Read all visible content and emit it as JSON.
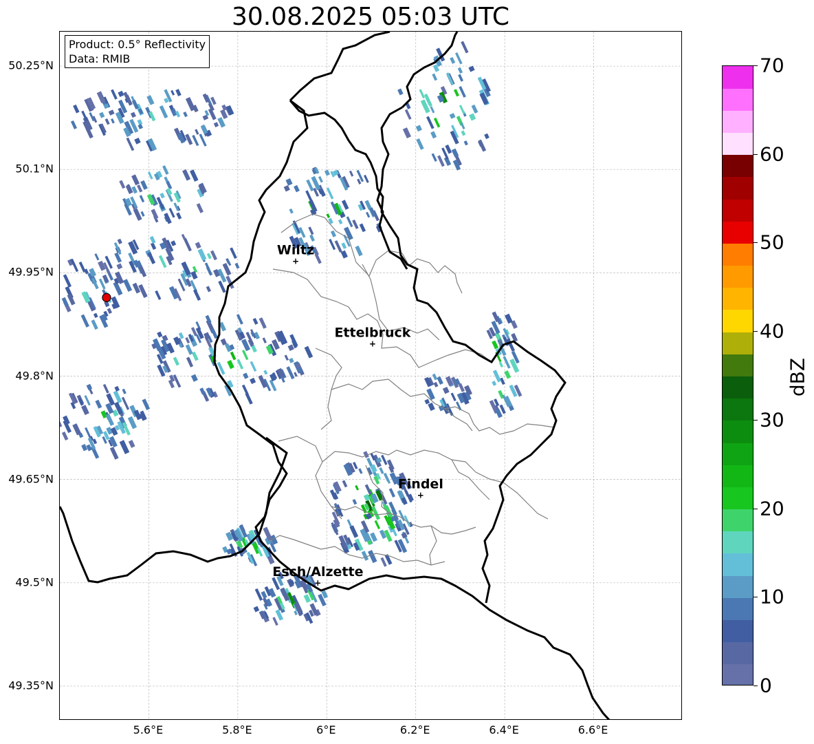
{
  "title": "30.08.2025 05:03 UTC",
  "info": {
    "product": "Product: 0.5° Reflectivity",
    "data": "Data: RMIB"
  },
  "map": {
    "lon_range": [
      5.4,
      6.8
    ],
    "lat_range": [
      49.3,
      50.3
    ],
    "lat_ticks": [
      {
        "value": 50.25,
        "label": "50.25°N"
      },
      {
        "value": 50.1,
        "label": "50.1°N"
      },
      {
        "value": 49.95,
        "label": "49.95°N"
      },
      {
        "value": 49.8,
        "label": "49.8°N"
      },
      {
        "value": 49.65,
        "label": "49.65°N"
      },
      {
        "value": 49.5,
        "label": "49.5°N"
      },
      {
        "value": 49.35,
        "label": "49.35°N"
      }
    ],
    "lon_ticks": [
      {
        "value": 5.6,
        "label": "5.6°E"
      },
      {
        "value": 5.8,
        "label": "5.8°E"
      },
      {
        "value": 6.0,
        "label": "6°E"
      },
      {
        "value": 6.2,
        "label": "6.2°E"
      },
      {
        "value": 6.4,
        "label": "6.4°E"
      },
      {
        "value": 6.6,
        "label": "6.6°E"
      }
    ],
    "cities": [
      {
        "name": "Wiltz",
        "lon": 5.93,
        "lat": 49.967
      },
      {
        "name": "Ettelbruck",
        "lon": 6.103,
        "lat": 49.847
      },
      {
        "name": "Findel",
        "lon": 6.211,
        "lat": 49.627
      },
      {
        "name": "Esch/Alzette",
        "lon": 5.98,
        "lat": 49.5
      }
    ],
    "radar_site": {
      "lon": 5.505,
      "lat": 49.914
    },
    "border_color": "#000000",
    "canton_color": "#808080",
    "grid_color": "#bbbbbb"
  },
  "colorbar": {
    "label": "dBZ",
    "min": 0,
    "max": 70,
    "step": 2.5,
    "ticks": [
      0,
      10,
      20,
      30,
      40,
      50,
      60,
      70
    ],
    "colors": [
      "#6571a8",
      "#5768a2",
      "#405ea1",
      "#4b78b2",
      "#5a9cc6",
      "#63bfd8",
      "#5fd5be",
      "#3fd46b",
      "#17c61f",
      "#12b716",
      "#0fa413",
      "#0d8d10",
      "#0b770e",
      "#0a5e0c",
      "#427a0e",
      "#afaf09",
      "#ffd700",
      "#ffb400",
      "#ff9a00",
      "#ff7d00",
      "#e80000",
      "#c00000",
      "#a00000",
      "#780000",
      "#ffe0ff",
      "#ffb0ff",
      "#ff70ff",
      "#ee30ee"
    ]
  }
}
